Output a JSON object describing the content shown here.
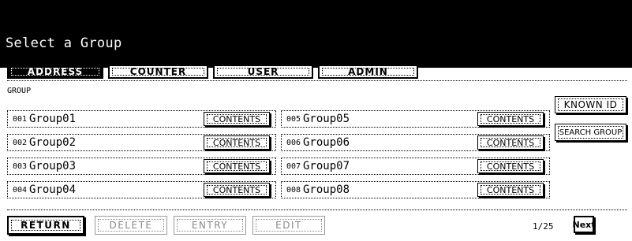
{
  "header": {
    "title": "Select a Group"
  },
  "tabs": [
    {
      "label": "ADDRESS",
      "active": true
    },
    {
      "label": "COUNTER",
      "active": false
    },
    {
      "label": "USER",
      "active": false
    },
    {
      "label": "ADMIN",
      "active": false
    }
  ],
  "group_label": "GROUP",
  "groups": [
    {
      "num": "001",
      "name": "Group01",
      "button": "CONTENTS"
    },
    {
      "num": "002",
      "name": "Group02",
      "button": "CONTENTS"
    },
    {
      "num": "003",
      "name": "Group03",
      "button": "CONTENTS"
    },
    {
      "num": "004",
      "name": "Group04",
      "button": "CONTENTS"
    },
    {
      "num": "005",
      "name": "Group05",
      "button": "CONTENTS"
    },
    {
      "num": "006",
      "name": "Group06",
      "button": "CONTENTS"
    },
    {
      "num": "007",
      "name": "Group07",
      "button": "CONTENTS"
    },
    {
      "num": "008",
      "name": "Group08",
      "button": "CONTENTS"
    }
  ],
  "side_buttons": {
    "known_id": "KNOWN ID",
    "search_group": "SEARCH GROUP"
  },
  "footer": {
    "return_label": "RETURN",
    "delete_label": "DELETE",
    "entry_label": "ENTRY",
    "edit_label": "EDIT",
    "page_indicator": "1/25",
    "next_label": "Next"
  }
}
